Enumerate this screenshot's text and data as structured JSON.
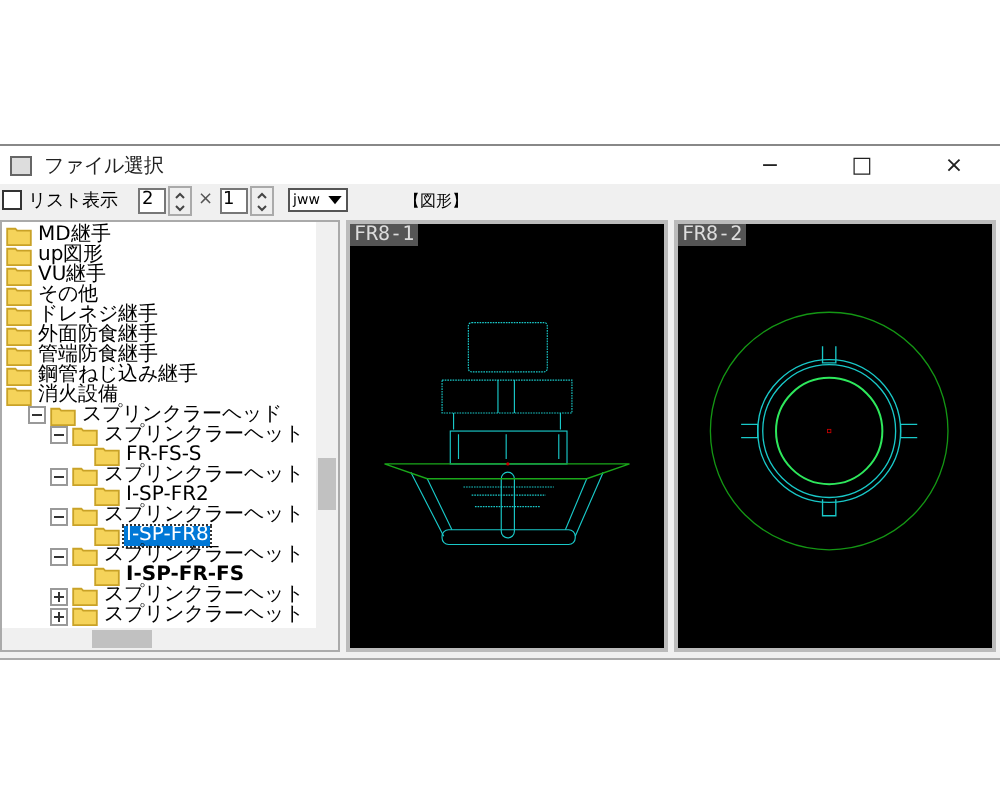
{
  "window": {
    "title": "ファイル選択",
    "controls": [
      "−",
      "□",
      "×"
    ]
  },
  "toolbar": {
    "list_view": {
      "label": "リスト表示",
      "checked": false
    },
    "rows": "2",
    "times": "×",
    "cols": "1",
    "format": "jww",
    "section_label": "【図形】"
  },
  "tree": [
    {
      "label": "MD継手",
      "selected": false,
      "bold": false
    },
    {
      "label": "up図形",
      "selected": false,
      "bold": false
    },
    {
      "label": "VU継手",
      "selected": false,
      "bold": false
    },
    {
      "label": "その他",
      "selected": false,
      "bold": false
    },
    {
      "label": "ドレネジ継手",
      "selected": false,
      "bold": false
    },
    {
      "label": "外面防食継手",
      "selected": false,
      "bold": false
    },
    {
      "label": "管端防食継手",
      "selected": false,
      "bold": false
    },
    {
      "label": "鋼管ねじ込み継手",
      "selected": false,
      "bold": false
    },
    {
      "label": "消火設備",
      "expanded": true,
      "selected": false,
      "bold": false,
      "children": [
        {
          "label": "スプリンクラーヘッド",
          "expanded": true,
          "selected": false,
          "bold": false,
          "children": [
            {
              "label": "スプリンクラーヘット",
              "expanded": true,
              "selected": false,
              "bold": false,
              "children": [
                {
                  "label": "FR-FS-S",
                  "selected": false,
                  "bold": false
                }
              ]
            },
            {
              "label": "スプリンクラーヘット",
              "expanded": true,
              "selected": false,
              "bold": false,
              "children": [
                {
                  "label": "I-SP-FR2",
                  "selected": false,
                  "bold": false
                }
              ]
            },
            {
              "label": "スプリンクラーヘット",
              "expanded": true,
              "selected": false,
              "bold": false,
              "children": [
                {
                  "label": "I-SP-FR8",
                  "selected": true,
                  "bold": false
                }
              ]
            },
            {
              "label": "スプリンクラーヘット",
              "expanded": true,
              "selected": false,
              "bold": false,
              "children": [
                {
                  "label": "I-SP-FR-FS",
                  "selected": false,
                  "bold": true
                }
              ]
            },
            {
              "label": "スプリンクラーヘット",
              "expanded": false,
              "selected": false,
              "bold": false
            },
            {
              "label": "スプリンクラーヘット",
              "expanded": false,
              "selected": false,
              "bold": false
            }
          ]
        }
      ]
    }
  ],
  "views": [
    {
      "label": "FR8-1",
      "kind": "side"
    },
    {
      "label": "FR8-2",
      "kind": "top"
    }
  ]
}
